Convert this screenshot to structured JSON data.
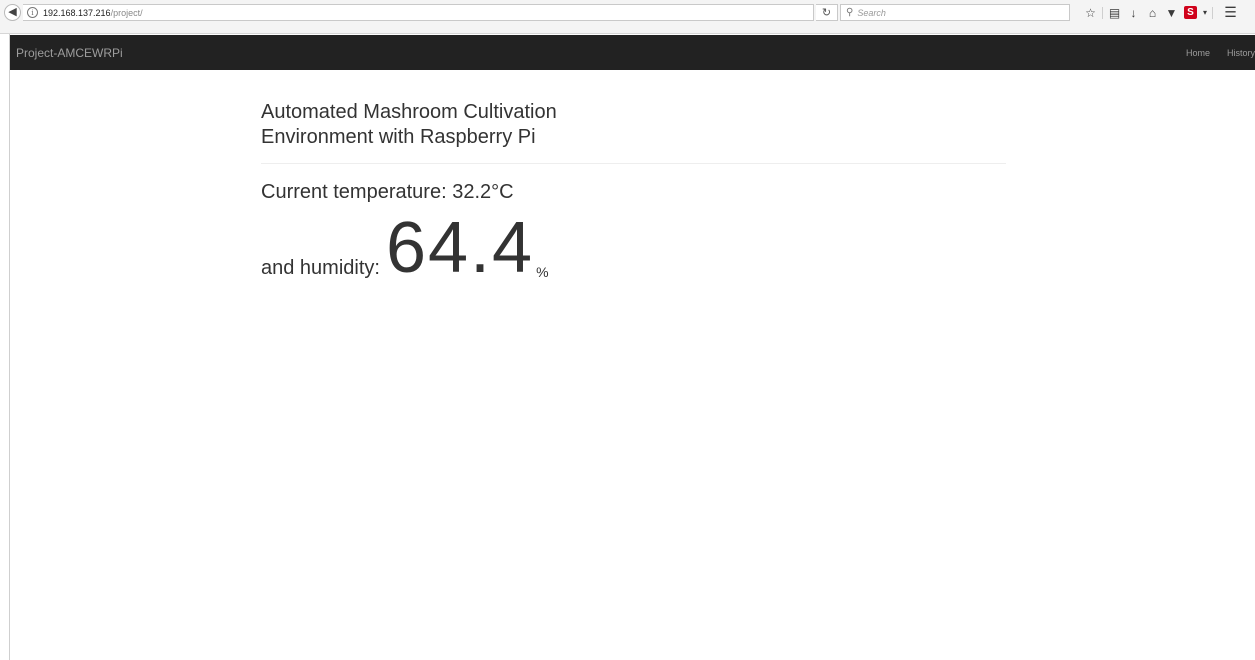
{
  "browser": {
    "url_host": "192.168.137.216",
    "url_path": "/project/",
    "search_placeholder": "Search"
  },
  "navbar": {
    "brand": "Project-AMCEWRPi",
    "links": [
      {
        "label": "Home"
      },
      {
        "label": "History"
      }
    ]
  },
  "main": {
    "title": "Automated Mashroom Cultivation Environment with Raspberry Pi",
    "temperature_text": "Current temperature: 32.2°C",
    "humidity_label": "and humidity:",
    "humidity_value": "64.4",
    "humidity_unit": "%"
  }
}
